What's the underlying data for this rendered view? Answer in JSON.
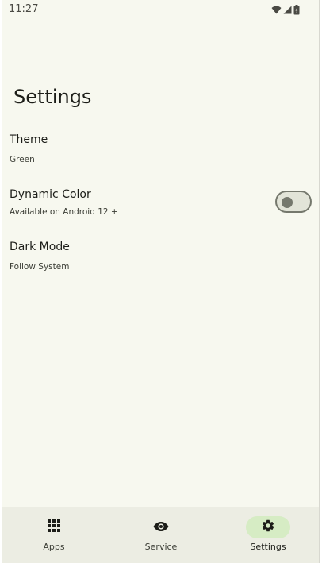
{
  "status_bar": {
    "time": "11:27",
    "icons": [
      "wifi-icon",
      "signal-icon",
      "battery-icon"
    ]
  },
  "page": {
    "title": "Settings"
  },
  "settings": [
    {
      "title": "Theme",
      "subtitle": "Green"
    },
    {
      "title": "Dynamic Color",
      "subtitle": "Available on Android 12 +",
      "toggle_on": false
    },
    {
      "title": "Dark Mode",
      "subtitle": "Follow System"
    }
  ],
  "nav": {
    "items": [
      {
        "label": "Apps",
        "icon": "apps-grid-icon",
        "active": false
      },
      {
        "label": "Service",
        "icon": "eye-icon",
        "active": false
      },
      {
        "label": "Settings",
        "icon": "gear-icon",
        "active": true
      }
    ]
  },
  "colors": {
    "background": "#f7f8ef",
    "nav_background": "#ecede3",
    "active_pill": "#d6ecc4",
    "text_primary": "#1c1d18"
  }
}
